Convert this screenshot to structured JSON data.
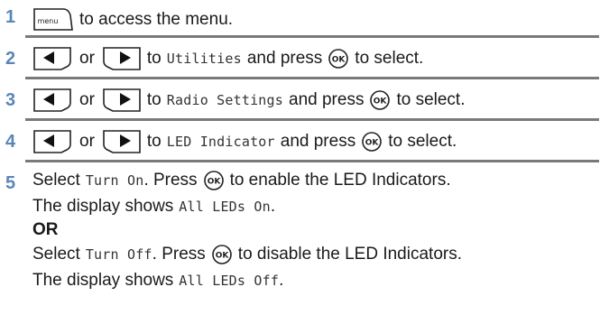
{
  "icons": {
    "menu": "menu-key-icon",
    "left": "left-arrow-key-icon",
    "right": "right-arrow-key-icon",
    "ok": "ok-key-icon"
  },
  "menu_icon_text": "menu",
  "ok_icon_text": "OK",
  "or_word": "or",
  "steps": [
    {
      "number": "1",
      "text": "to access the menu."
    },
    {
      "number": "2",
      "to": "to",
      "item": "Utilities",
      "press": "and press",
      "select": "to select."
    },
    {
      "number": "3",
      "to": "to",
      "item": "Radio Settings",
      "press": "and press",
      "select": "to select."
    },
    {
      "number": "4",
      "to": "to",
      "item": "LED Indicator",
      "press": "and press",
      "select": "to select."
    },
    {
      "number": "5",
      "select_word": "Select",
      "turn_on": "Turn On",
      "press_word": ". Press",
      "enable_text": "to enable the LED Indicators.",
      "display_shows": "The display shows",
      "all_on": "All LEDs On",
      "period": ".",
      "or_bold": "OR",
      "turn_off": "Turn Off",
      "disable_text": "to disable the LED Indicators.",
      "all_off": "All LEDs Off"
    }
  ],
  "colors": {
    "step_number": "#5a86b8",
    "separator": "#7a7a7a"
  }
}
